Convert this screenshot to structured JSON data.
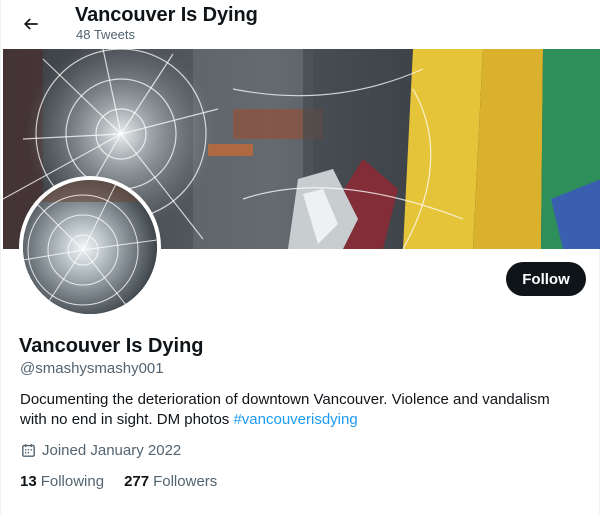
{
  "header": {
    "back_icon": "arrow-left-icon",
    "name": "Vancouver Is Dying",
    "tweet_count": "48 Tweets"
  },
  "profile": {
    "display_name": "Vancouver Is Dying",
    "handle": "@smashysmashy001",
    "bio_text": "Documenting the deterioration of downtown Vancouver. Violence and vandalism with no end in sight. DM photos ",
    "bio_hashtag": "#vancouverisdying",
    "joined_icon": "calendar-icon",
    "joined": "Joined January 2022",
    "following_count": "13",
    "following_label": "Following",
    "followers_count": "277",
    "followers_label": "Followers"
  },
  "actions": {
    "follow_label": "Follow"
  },
  "colors": {
    "accent": "#1d9bf0",
    "button_bg": "#0f1419",
    "secondary_text": "#536471"
  }
}
